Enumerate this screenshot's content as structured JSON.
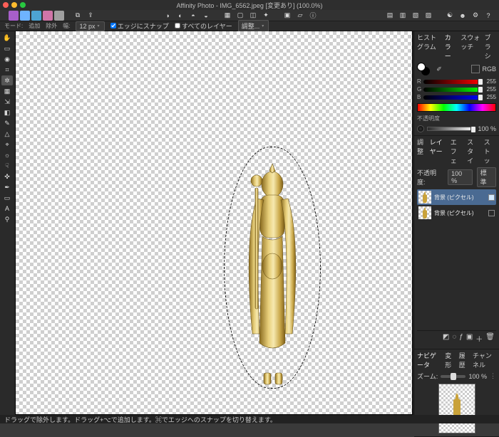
{
  "title": "Affinity Photo - IMG_6562.jpeg [変更あり] (100.0%)",
  "context": {
    "mode_lbl": "モード:",
    "mode_add": "追加",
    "mode_sub": "除外",
    "width_lbl": "幅:",
    "width_val": "12 px",
    "snap_lbl": "エッジにスナップ",
    "alllayers_lbl": "すべてのレイヤー",
    "refine_btn": "調整..."
  },
  "color": {
    "tabs": [
      "ヒストグラム",
      "カラー",
      "スウォッチ",
      "ブラシ"
    ],
    "active_tab": 1,
    "model": "RGB",
    "r": {
      "ch": "R",
      "val": "255"
    },
    "g": {
      "ch": "G",
      "val": "255"
    },
    "b": {
      "ch": "B",
      "val": "255"
    },
    "opacity_lbl": "不透明度",
    "opacity_val": "100 %"
  },
  "layers": {
    "tabs": [
      "調整",
      "レイヤー",
      "エフェ",
      "スタイ",
      "ストッ"
    ],
    "active_tab": 1,
    "opacity_lbl": "不透明度:",
    "opacity_val": "100 %",
    "blend_val": "標準",
    "items": [
      {
        "name": "背景 (ピクセル)",
        "selected": true,
        "visible": true
      },
      {
        "name": "背景 (ピクセル)",
        "selected": false,
        "visible": false
      }
    ]
  },
  "navigator": {
    "tabs": [
      "ナビゲータ",
      "変形",
      "履歴",
      "チャンネル"
    ],
    "active_tab": 0,
    "zoom_lbl": "ズーム:",
    "zoom_val": "100 %"
  },
  "status": "ドラッグで除外します。ドラッグ+⌥で追加します。⌘でエッジへのスナップを切り替えます。"
}
